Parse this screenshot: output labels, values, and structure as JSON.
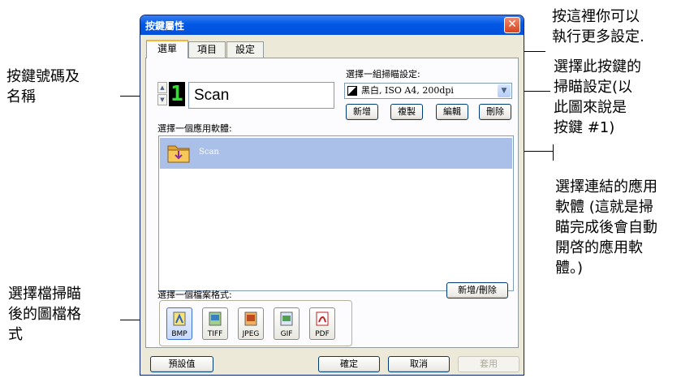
{
  "window": {
    "title": "按鍵屬性",
    "close_glyph": "✕",
    "tabs": [
      {
        "label": "選單"
      },
      {
        "label": "項目"
      },
      {
        "label": "設定"
      }
    ]
  },
  "button_panel": {
    "button_number": "1",
    "button_name": "Scan",
    "scan_setting_label": "選擇一組掃瞄設定:",
    "scan_setting_value": "黑白, ISO A4, 200dpi",
    "actions": [
      "新增",
      "複製",
      "編輯",
      "刪除"
    ],
    "app_label": "選擇一個應用軟體:",
    "apps": [
      {
        "name": "Scan",
        "icon": "folder-icon"
      }
    ],
    "format_label": "選擇一個檔案格式:",
    "add_remove_label": "新增/刪除",
    "formats": [
      {
        "label": "BMP",
        "icon": "bmp-icon"
      },
      {
        "label": "TIFF",
        "icon": "tiff-icon"
      },
      {
        "label": "JPEG",
        "icon": "jpeg-icon"
      },
      {
        "label": "GIF",
        "icon": "gif-icon"
      },
      {
        "label": "PDF",
        "icon": "pdf-icon"
      }
    ]
  },
  "footer": {
    "defaults": "預設值",
    "ok": "確定",
    "cancel": "取消",
    "apply": "套用"
  },
  "callouts": {
    "more_settings": "按這裡你可以\n執行更多設定.",
    "scan_setting": "選擇此按鍵的\n掃瞄設定(以\n此圖來說是\n按鍵  #1)",
    "button_name": "按鍵號碼及\n名稱",
    "linked_app": "選擇連結的應用\n軟體  (這就是掃\n瞄完成後會自動\n開啓的應用軟\n體。)",
    "file_format": "選擇檔掃瞄\n後的圖檔格\n式"
  },
  "colors": {
    "titlebar": "#0058e6",
    "selected_row": "#aac0e8",
    "digit_segment": "#2fe02f"
  }
}
